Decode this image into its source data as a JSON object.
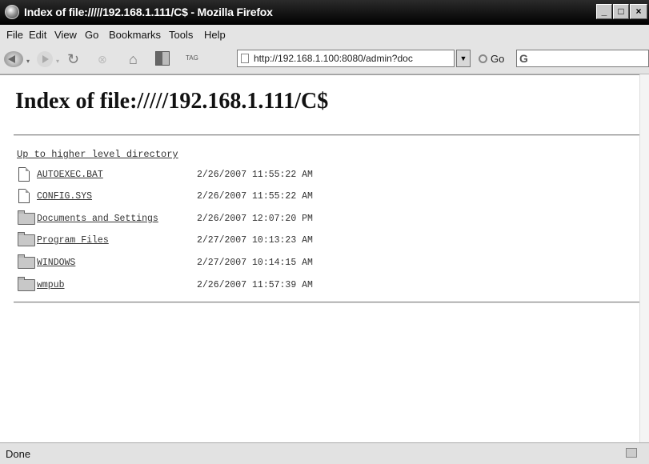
{
  "window": {
    "title": "Index of file://///192.168.1.111/C$ - Mozilla Firefox",
    "controls": {
      "minimize": "_",
      "maximize": "□",
      "close": "×"
    }
  },
  "menu": [
    {
      "label": "File"
    },
    {
      "label": "Edit"
    },
    {
      "label": "View"
    },
    {
      "label": "Go"
    },
    {
      "label": "Bookmarks"
    },
    {
      "label": "Tools"
    },
    {
      "label": "Help"
    }
  ],
  "toolbar": {
    "url": "http://192.168.1.100:8080/admin?doc",
    "go_label": "Go",
    "tag_label": "TAG",
    "search_engine_glyph": "G"
  },
  "page": {
    "heading": "Index of file://///192.168.1.111/C$",
    "up_link": "Up to higher level directory",
    "entries": [
      {
        "type": "file",
        "name": "AUTOEXEC.BAT",
        "date": "2/26/2007 11:55:22 AM"
      },
      {
        "type": "file",
        "name": "CONFIG.SYS",
        "date": "2/26/2007 11:55:22 AM"
      },
      {
        "type": "folder",
        "name": "Documents and Settings",
        "date": "2/26/2007 12:07:20 PM"
      },
      {
        "type": "folder",
        "name": "Program Files",
        "date": "2/27/2007 10:13:23 AM"
      },
      {
        "type": "folder",
        "name": "WINDOWS",
        "date": "2/27/2007 10:14:15 AM"
      },
      {
        "type": "folder",
        "name": "wmpub",
        "date": "2/26/2007 11:57:39 AM"
      }
    ]
  },
  "status": {
    "text": "Done"
  }
}
